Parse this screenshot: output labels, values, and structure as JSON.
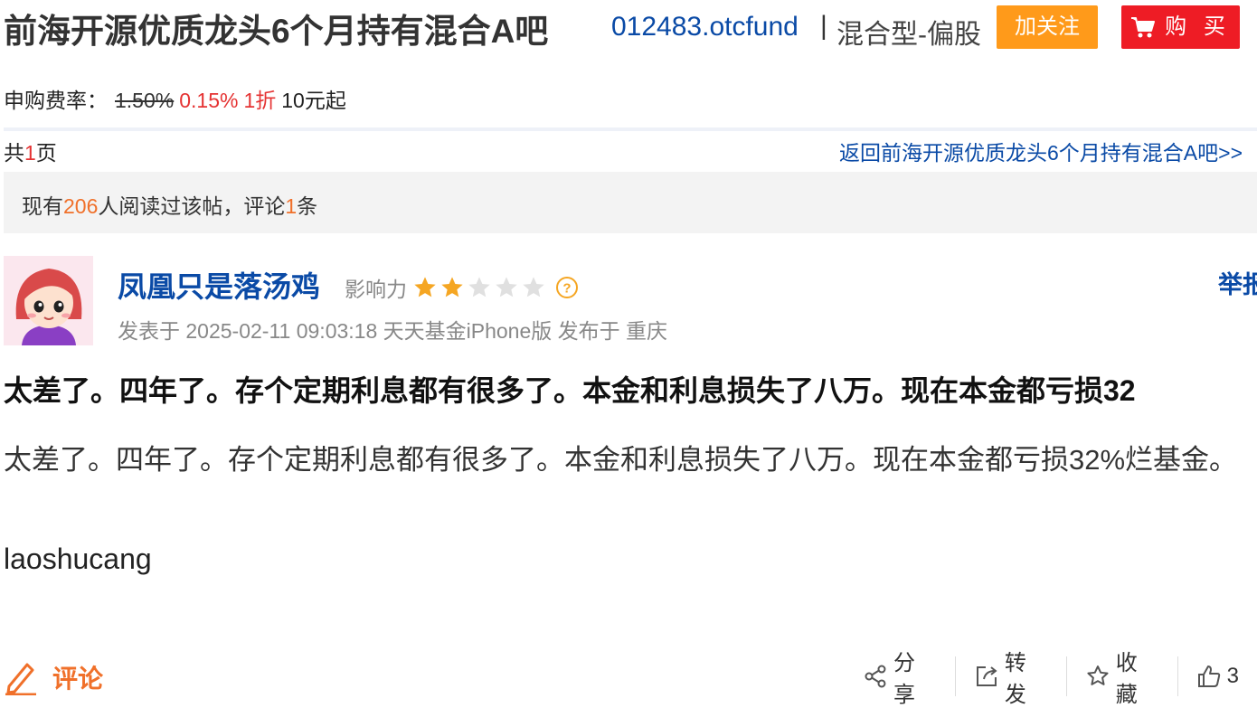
{
  "header": {
    "bar_name": "前海开源优质龙头6个月持有混合A吧",
    "fund_code": "012483.otcfund",
    "separator": "|",
    "fund_type": "混合型-偏股",
    "follow_label": "加关注",
    "buy_label": "购 买",
    "colors": {
      "follow": "#ff9a1a",
      "buy": "#ee1c25",
      "link": "#0a4aa6"
    }
  },
  "fee": {
    "label": "申购费率：",
    "original": "1.50%",
    "discounted": "0.15%",
    "discount": "1折",
    "minimum": "10元起"
  },
  "pagination": {
    "prefix": "共",
    "count": "1",
    "suffix": "页",
    "back_link": "返回前海开源优质龙头6个月持有混合A吧>>"
  },
  "stats": {
    "prefix": "现有",
    "readers": "206",
    "middle": "人阅读过该帖，评论",
    "comments": "1",
    "suffix": "条"
  },
  "author": {
    "name": "凤凰只是落汤鸡",
    "influence_label": "影响力",
    "stars_filled": 2,
    "stars_total": 5,
    "report_label": "举报",
    "post_meta": "发表于 2025-02-11 09:03:18 天天基金iPhone版 发布于 重庆"
  },
  "post": {
    "title": "太差了。四年了。存个定期利息都有很多了。本金和利息损失了八万。现在本金都亏损32",
    "body": "太差了。四年了。存个定期利息都有很多了。本金和利息损失了八万。现在本金都亏损32%烂基金。",
    "signature": "laoshucang"
  },
  "actions": {
    "comment_label": "评论",
    "share_label": "分享",
    "repost_label": "转发",
    "favorite_label": "收藏",
    "like_count": "3"
  },
  "icons": [
    "cart-icon",
    "star-icon",
    "help-icon",
    "pen-icon",
    "share-icon",
    "repost-icon",
    "favorite-icon",
    "like-icon"
  ]
}
